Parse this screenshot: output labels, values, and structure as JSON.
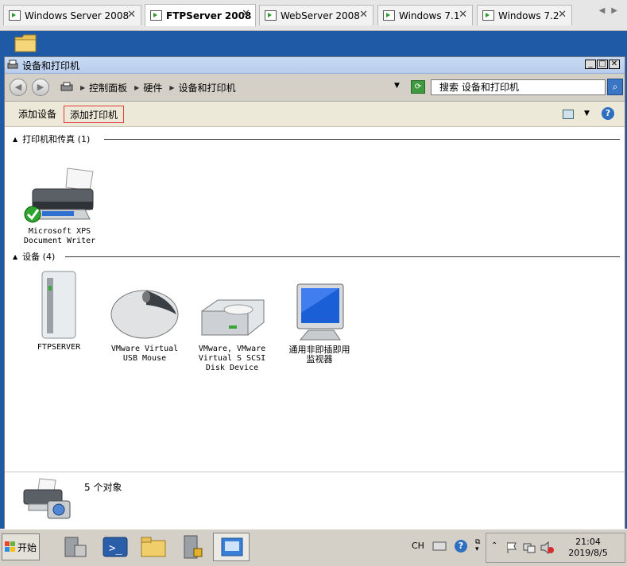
{
  "vm_tabs": [
    {
      "label": "Windows Server 2008",
      "active": false
    },
    {
      "label": "FTPServer 2008",
      "active": true
    },
    {
      "label": "WebServer 2008",
      "active": false
    },
    {
      "label": "Windows 7.1",
      "active": false
    },
    {
      "label": "Windows 7.2",
      "active": false
    }
  ],
  "window": {
    "title": "设备和打印机",
    "breadcrumb": [
      "控制面板",
      "硬件",
      "设备和打印机"
    ],
    "search_placeholder": "搜索 设备和打印机"
  },
  "commands": {
    "add_device": "添加设备",
    "add_printer": "添加打印机"
  },
  "groups": {
    "printers": {
      "header": "打印机和传真 (1)",
      "items": [
        {
          "line1": "Microsoft XPS",
          "line2": "Document Writer",
          "line3": ""
        }
      ]
    },
    "devices": {
      "header": "设备 (4)",
      "items": [
        {
          "line1": "FTPSERVER",
          "line2": "",
          "line3": ""
        },
        {
          "line1": "VMware Virtual",
          "line2": "USB Mouse",
          "line3": ""
        },
        {
          "line1": "VMware, VMware",
          "line2": "Virtual S SCSI",
          "line3": "Disk Device"
        },
        {
          "line1": "通用非即插即用",
          "line2": "监视器",
          "line3": ""
        }
      ]
    }
  },
  "status": {
    "count_text": "5 个对象"
  },
  "taskbar": {
    "start_label": "开始",
    "ime": "CH",
    "time": "21:04",
    "date": "2019/8/5"
  },
  "colors": {
    "selection_outline": "#e23a3a",
    "taskbar": "#d4d0c8"
  }
}
